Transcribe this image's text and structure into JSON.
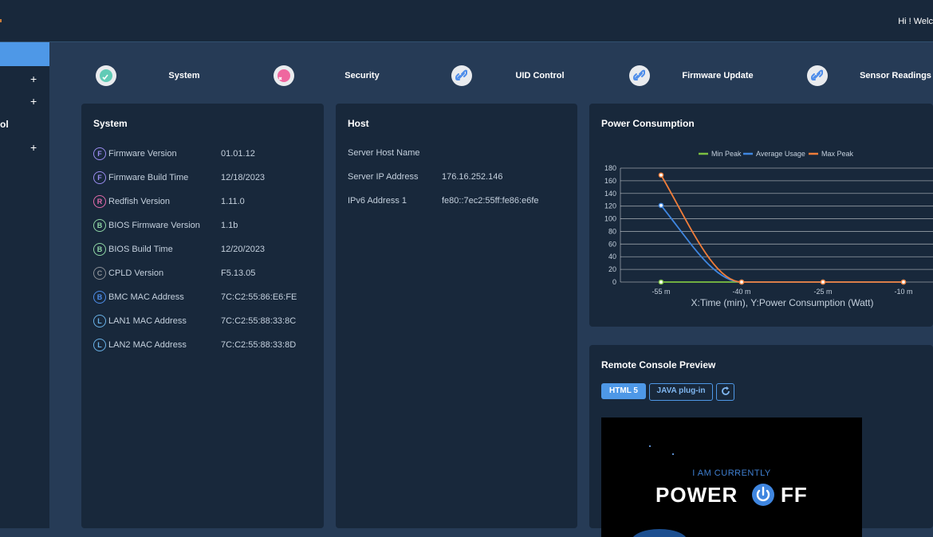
{
  "header": {
    "greeting": "Hi ! Welc"
  },
  "sidebar": {
    "items": [
      {
        "label": ""
      },
      {
        "label": ""
      },
      {
        "label": "ol"
      },
      {
        "label": ""
      }
    ]
  },
  "tiles": [
    {
      "label": "System",
      "color": "#61cbb6",
      "icon": "check-circle-icon"
    },
    {
      "label": "Security",
      "color": "#ef679f",
      "icon": "x-circle-icon"
    },
    {
      "label": "UID Control",
      "color": "#4e8dea",
      "icon": "link-icon"
    },
    {
      "label": "Firmware Update",
      "color": "#4e8dea",
      "icon": "link-icon"
    },
    {
      "label": "Sensor Readings",
      "color": "#4e8dea",
      "icon": "link-icon"
    }
  ],
  "system": {
    "title": "System",
    "rows": [
      {
        "badge": "F",
        "label": "Firmware Version",
        "value": "01.01.12",
        "color": "#9a8cf0"
      },
      {
        "badge": "F",
        "label": "Firmware Build Time",
        "value": "12/18/2023",
        "color": "#9a8cf0"
      },
      {
        "badge": "R",
        "label": "Redfish Version",
        "value": "1.11.0",
        "color": "#e06aa9"
      },
      {
        "badge": "B",
        "label": "BIOS Firmware Version",
        "value": "1.1b",
        "color": "#8fd6a5"
      },
      {
        "badge": "B",
        "label": "BIOS Build Time",
        "value": "12/20/2023",
        "color": "#8fd6a5"
      },
      {
        "badge": "C",
        "label": "CPLD Version",
        "value": "F5.13.05",
        "color": "#8a8f96"
      },
      {
        "badge": "B",
        "label": "BMC MAC Address",
        "value": "7C:C2:55:86:E6:FE",
        "color": "#4e8dea"
      },
      {
        "badge": "L",
        "label": "LAN1 MAC Address",
        "value": "7C:C2:55:88:33:8C",
        "color": "#6ab2e8"
      },
      {
        "badge": "L",
        "label": "LAN2 MAC Address",
        "value": "7C:C2:55:88:33:8D",
        "color": "#6ab2e8"
      }
    ]
  },
  "host": {
    "title": "Host",
    "rows": [
      {
        "label": "Server Host Name",
        "value": ""
      },
      {
        "label": "Server IP Address",
        "value": "176.16.252.146"
      },
      {
        "label": "IPv6 Address 1",
        "value": "fe80::7ec2:55ff:fe86:e6fe"
      }
    ]
  },
  "power": {
    "title": "Power Consumption"
  },
  "chart_data": {
    "type": "line",
    "categories": [
      "-55 m",
      "-40 m",
      "-25 m",
      "-10 m"
    ],
    "series": [
      {
        "name": "Min Peak",
        "values": [
          0,
          0,
          0,
          0
        ],
        "color": "#7cc142"
      },
      {
        "name": "Average Usage",
        "values": [
          121,
          0,
          0,
          0
        ],
        "color": "#3f86e0"
      },
      {
        "name": "Max Peak",
        "values": [
          169,
          0,
          0,
          0
        ],
        "color": "#f07d3a"
      }
    ],
    "xlabel": "X:Time (min), Y:Power Consumption (Watt)",
    "ylabel": "",
    "ylim": [
      0,
      180
    ],
    "yticks": [
      0,
      20,
      40,
      60,
      80,
      100,
      120,
      140,
      160,
      180
    ],
    "grid": true,
    "legend": "top"
  },
  "console": {
    "title": "Remote Console Preview",
    "html5_label": "HTML 5",
    "java_label": "JAVA plug-in",
    "status_line": "I AM CURRENTLY",
    "power_text": "POWER",
    "ff_text": "FF"
  }
}
